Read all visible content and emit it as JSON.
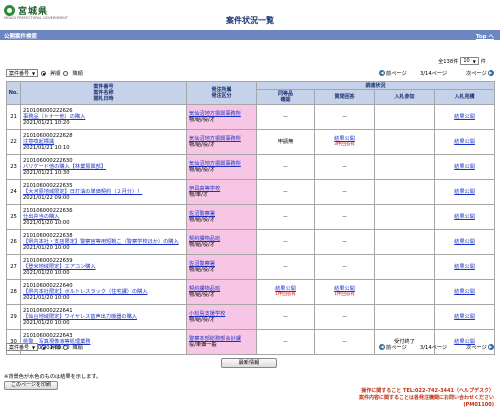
{
  "header": {
    "logo_text": "宮城県",
    "logo_sub": "MIYAGI PREFECTURAL GOVERNMENT",
    "title": "案件状況一覧"
  },
  "sysbar": {
    "label": "公開案件検索",
    "top_link": "Top へ"
  },
  "total": {
    "prefix": "全138件",
    "per_page": "10",
    "suffix": "件"
  },
  "pager": {
    "sort_value": "案件番号",
    "asc_label": "昇順",
    "desc_label": "降順",
    "sort_order": "asc",
    "prev_label": "前ページ",
    "page_info": "3/14ページ",
    "next_label": "次ページ"
  },
  "columns": {
    "no": "No.",
    "case": "案件番号\n案件名称\n開札日時",
    "org": "発注所属\n発注区分",
    "procedure": "調達状況",
    "participation": "同等品\n確認",
    "question": "質問回答",
    "bid_join": "入札参加",
    "bid_result": "入札見積"
  },
  "rows": [
    {
      "no": "21",
      "id": "210106000222626",
      "name": "事務品（トナー他）の購入",
      "date": "2021/01/21 10:20",
      "org": "気仙沼地方振興事務所",
      "cat": "物/給/役/オ",
      "eq": "－",
      "q": "－",
      "q_red": "",
      "join": "",
      "result": "結果公開"
    },
    {
      "no": "22",
      "id": "210106000222628",
      "name": "注意喚起標識",
      "date": "2021/01/21 10:10",
      "org": "気仙沼地方振興事務所",
      "cat": "物/給/役/オ",
      "eq": "申請無",
      "q": "結果公開",
      "q_red": "3件回答有",
      "join": "",
      "result": "結果公開"
    },
    {
      "no": "23",
      "id": "210106000222630",
      "name": "バリケード他の購入【林業振興部】",
      "date": "2021/01/21 10:30",
      "org": "気仙沼地方振興事務所",
      "cat": "物/給/役/オ",
      "eq": "－",
      "q": "－",
      "q_red": "",
      "join": "",
      "result": "結果公開"
    },
    {
      "no": "24",
      "id": "210106000222635",
      "name": "【大河原地域限定】日灯油の単価契約（２月分）！",
      "date": "2021/01/22 09:00",
      "org": "伊具高等学校",
      "cat": "物/単/オ",
      "eq": "－",
      "q": "－",
      "q_red": "",
      "join": "",
      "result": "結果公開"
    },
    {
      "no": "25",
      "id": "210106000222636",
      "name": "仕出弁当の購入",
      "date": "2021/01/20 10:00",
      "org": "佐沼警察署",
      "cat": "物/給/役/オ",
      "eq": "－",
      "q": "－",
      "q_red": "",
      "join": "",
      "result": "結果公開"
    },
    {
      "no": "26",
      "id": "210106000222638",
      "name": "【県内本社・支店限定】警察官等用短靴こ（警察学校ほか）の購入",
      "date": "2021/01/20 10:00",
      "org": "契約課物品班",
      "cat": "物/給/役/オ",
      "eq": "－",
      "q": "－",
      "q_red": "",
      "join": "",
      "result": "結果公開"
    },
    {
      "no": "27",
      "id": "210106000222639",
      "name": "【登米地域限定】エアコン購入",
      "date": "2021/01/20 10:00",
      "org": "佐沼警察署",
      "cat": "物/給/役/オ",
      "eq": "－",
      "q": "－",
      "q_red": "",
      "join": "",
      "result": "結果公開"
    },
    {
      "no": "28",
      "id": "210106000222640",
      "name": "【県内本社限定】ボルトレスラック（住宅課）の購入",
      "date": "2021/01/20 10:00",
      "org": "契約課物品班",
      "cat": "物/給/役/オ",
      "eq": "結果公開",
      "eq_red": "1件回答有",
      "q": "結果公開",
      "q_red": "1件回答有",
      "join": "",
      "result": "結果公開"
    },
    {
      "no": "29",
      "id": "210106000222641",
      "name": "【仙台地域限定】ワイヤレス音声出力機器の購入",
      "date": "2021/01/20 10:00",
      "org": "小松島支援学校",
      "cat": "物/給/役/オ",
      "eq": "－",
      "q": "－",
      "q_red": "",
      "join": "",
      "result": "結果公開"
    },
    {
      "no": "30",
      "id": "210106000222643",
      "name": "県警　写真現像液等処理業務",
      "date": "2021/02/01 09:30",
      "org": "警察本部総務部会計課",
      "cat": "役/単価一般",
      "eq": "－",
      "q": "－",
      "q_red": "",
      "join": "受付終了",
      "result": "結果公開"
    }
  ],
  "bottom": {
    "latest_label": "最新情報",
    "note": "※背景色が水色のものは結果を示します。",
    "print_label": "このページを印刷",
    "contact_line1": "操作に関すること TEL:022-742-3441（ヘルプデスク）",
    "contact_line2": "案件内容に関することは各発注機関にお問い合わせください",
    "screen_id": "(PM01100)"
  }
}
